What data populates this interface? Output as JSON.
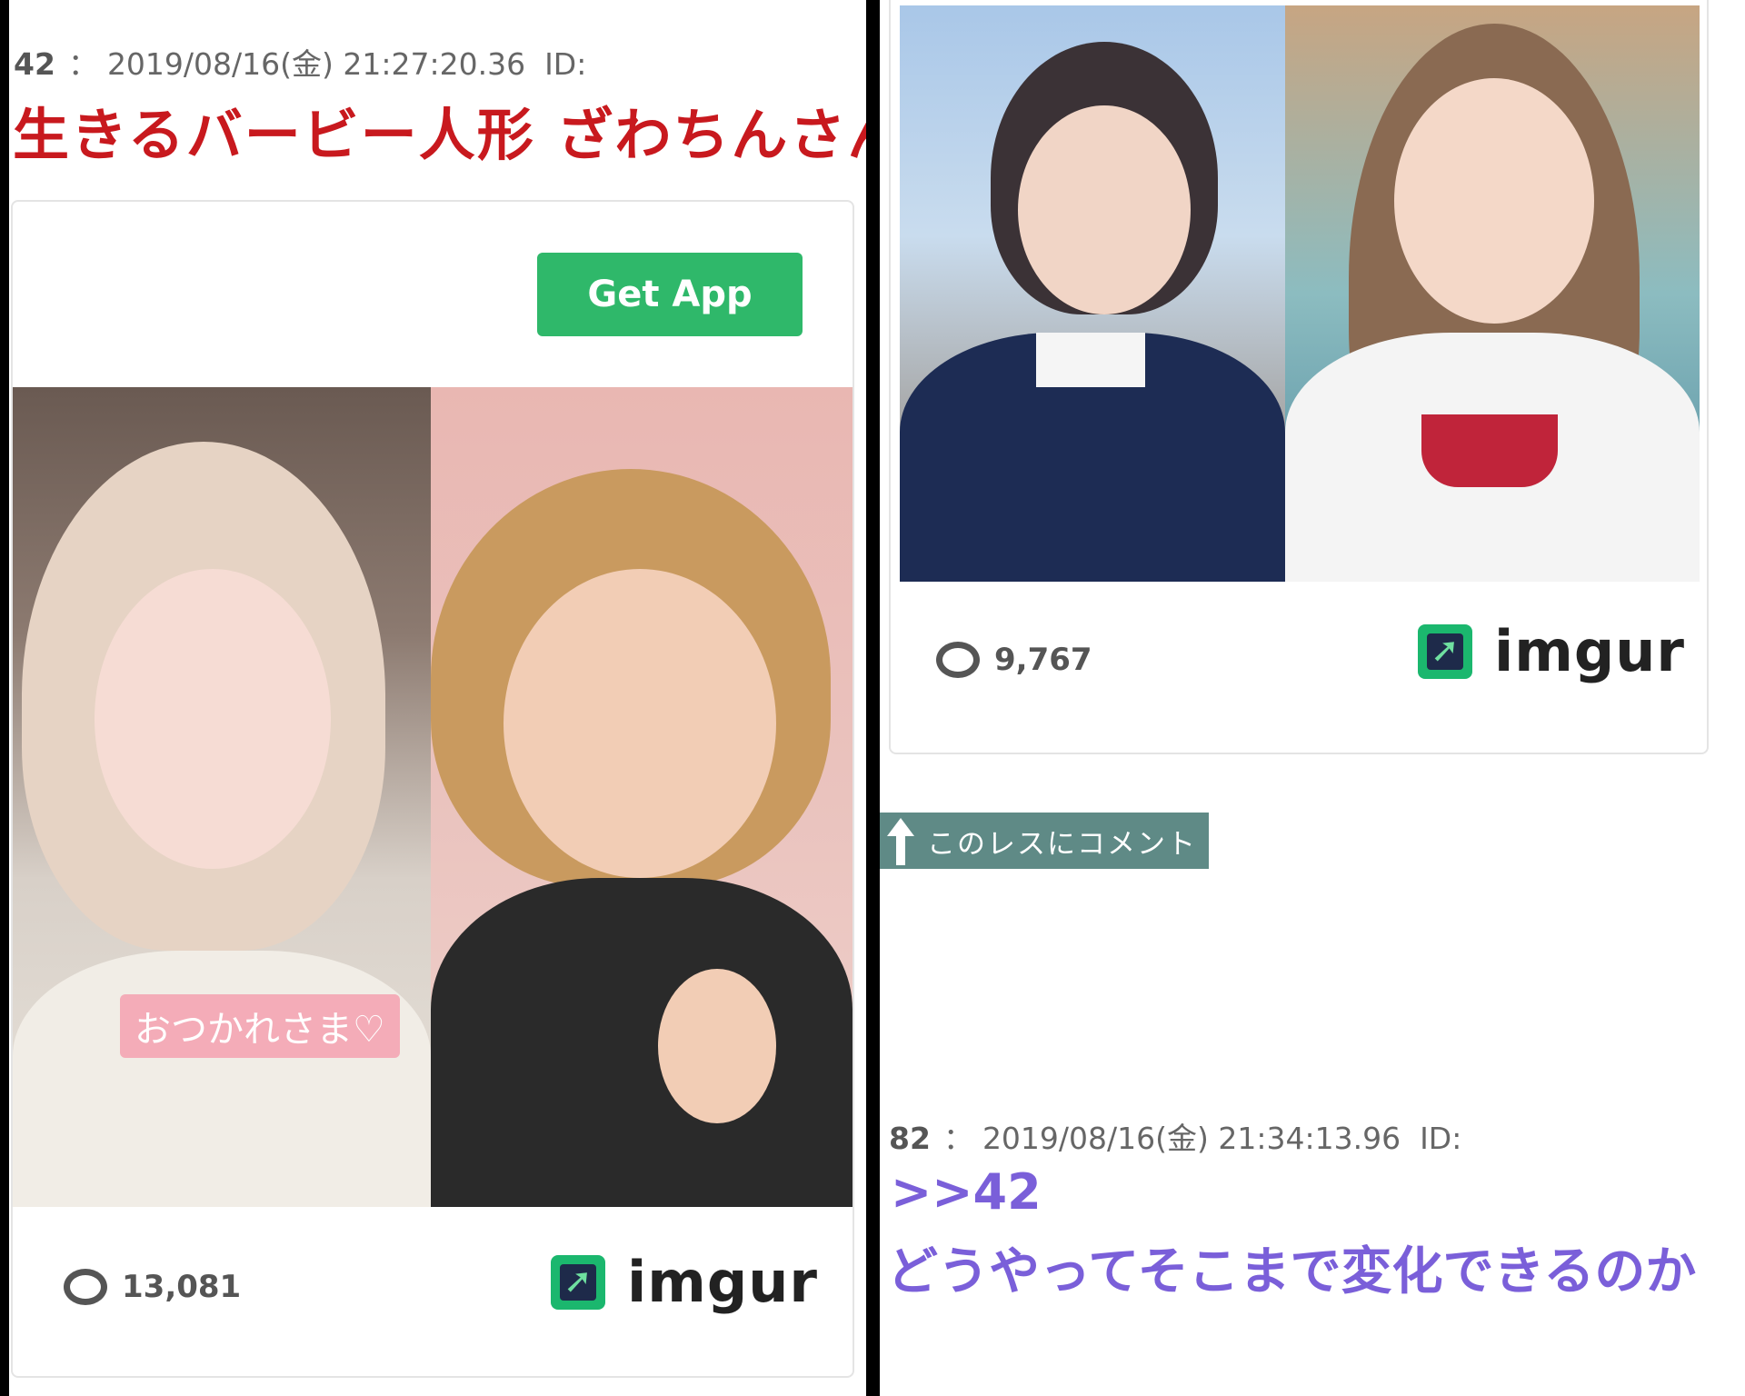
{
  "left_post": {
    "number": "42",
    "separator": "：",
    "datetime": "2019/08/16(金) 21:27:20.36",
    "id_label": "ID:",
    "title": "生きるバービー人形 ざわちんさん",
    "embed": {
      "get_app_label": "Get App",
      "image_caption": "おつかれさま♡",
      "views": "13,081",
      "brand": "imgur"
    }
  },
  "right_post": {
    "embed": {
      "views": "9,767",
      "brand": "imgur"
    },
    "comment_button": "このレスにコメント"
  },
  "reply_post": {
    "number": "82",
    "separator": "：",
    "datetime": "2019/08/16(金) 21:34:13.96",
    "id_label": "ID:",
    "reply_link": ">>42",
    "body": "どうやってそこまで変化できるのか"
  },
  "colors": {
    "title_red": "#c8191e",
    "get_app_green": "#2fb86a",
    "imgur_green": "#1bb76e",
    "comment_tab": "#5f8a86",
    "reply_purple": "#7a5fd9"
  }
}
